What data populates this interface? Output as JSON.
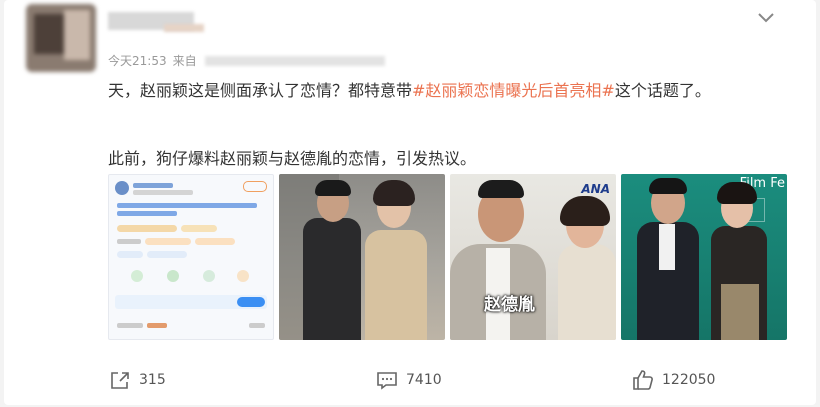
{
  "post": {
    "meta_time": "今天21:53",
    "meta_source_prefix": "来自",
    "text_before": "天，赵丽颖这是侧面承认了恋情？都特意带",
    "hashtag": "#赵丽颖恋情曝光后首亮相#",
    "text_after": "这个话题了。",
    "text2": "此前，狗仔爆料赵丽颖与赵德胤的恋情，引发热议。",
    "images": [
      {
        "name": "post-screenshot"
      },
      {
        "name": "couple-photo-1"
      },
      {
        "name": "couple-photo-2",
        "caption": "赵德胤",
        "logo": "ANA"
      },
      {
        "name": "couple-photo-3",
        "banner": "Film Fe"
      }
    ]
  },
  "actions": {
    "share_count": "315",
    "comment_count": "7410",
    "like_count": "122050"
  },
  "icons": {
    "more": "chevron-down-icon",
    "share": "share-icon",
    "comment": "comment-icon",
    "like": "thumbs-up-icon"
  },
  "colors": {
    "hashtag": "#eb7350",
    "text": "#333333",
    "meta": "#999999"
  }
}
